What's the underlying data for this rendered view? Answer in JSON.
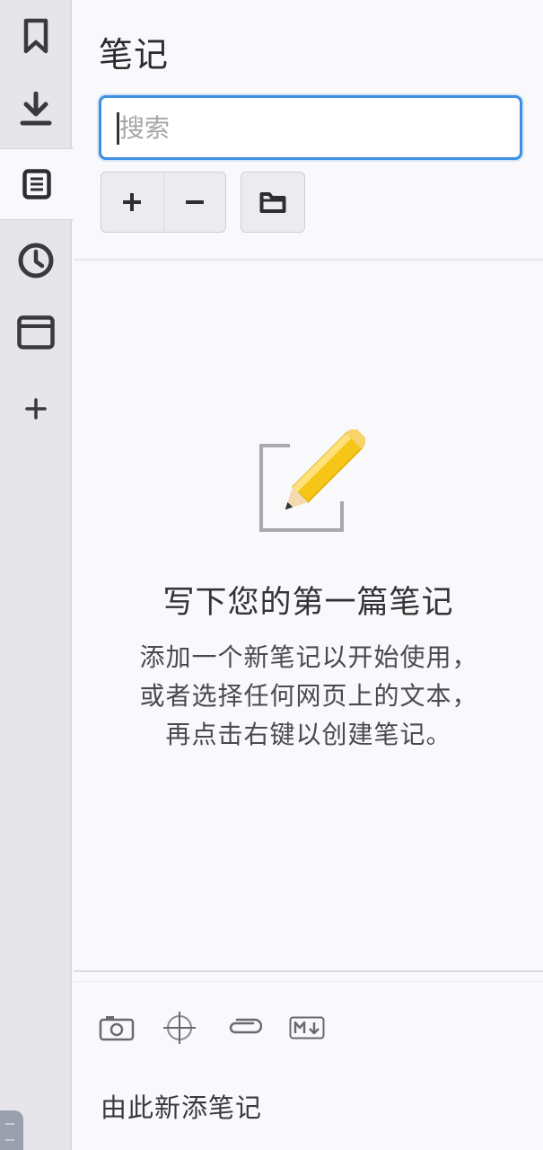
{
  "rail": {
    "items": [
      {
        "icon": "bookmark-icon",
        "active": false
      },
      {
        "icon": "download-icon",
        "active": false
      },
      {
        "icon": "notes-icon",
        "active": true
      },
      {
        "icon": "history-icon",
        "active": false
      },
      {
        "icon": "browser-window-icon",
        "active": false
      },
      {
        "icon": "add-icon",
        "active": false
      }
    ]
  },
  "header": {
    "title": "笔记",
    "search_placeholder": "搜索"
  },
  "empty_state": {
    "heading": "写下您的第一篇笔记",
    "body": "添加一个新笔记以开始使用，或者选择任何网页上的文本， 再点击右键以创建笔记。"
  },
  "footer": {
    "tools": [
      "camera-icon",
      "crosshair-icon",
      "paperclip-icon",
      "markdown-icon"
    ],
    "add_note_label": "由此新添笔记"
  },
  "colors": {
    "accent": "#3d8fe4",
    "rail_bg": "#e6e6ea",
    "panel_bg": "#f9f9fb",
    "icon": "#3a3a3d",
    "pencil_yellow": "#f5c518"
  }
}
